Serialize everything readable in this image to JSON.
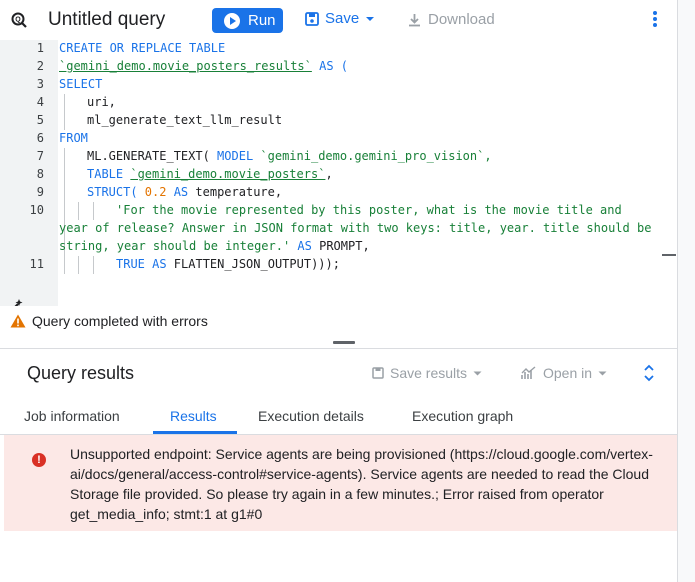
{
  "header": {
    "title": "Untitled query",
    "run_label": "Run",
    "save_label": "Save",
    "download_label": "Download"
  },
  "editor": {
    "line_numbers": [
      "1",
      "2",
      "3",
      "4",
      "5",
      "6",
      "7",
      "8",
      "9",
      "10",
      "11"
    ],
    "lines": {
      "l1_kw": "CREATE OR REPLACE TABLE",
      "l2_tbl": "`gemini_demo.movie_posters_results`",
      "l2_kw": " AS (",
      "l3_kw": "SELECT",
      "l4": "uri,",
      "l5": "ml_generate_text_llm_result",
      "l6_kw": "FROM",
      "l7_a": "ML.GENERATE_TEXT( ",
      "l7_kw": "MODEL",
      "l7_b": " `gemini_demo.gemini_pro_vision`,",
      "l8_kw": "TABLE",
      "l8_tbl": "`gemini_demo.movie_posters`",
      "l8_b": ",",
      "l9_kw": "STRUCT(",
      "l9_num": " 0.2",
      "l9_kw2": " AS",
      "l9_b": " temperature,",
      "l10_a": "'For the movie represented by this poster, what is the movie title and",
      "l10_b": "year of release? Answer in JSON format with two keys: title, year. title should be",
      "l10_c": "string, year should be integer.'",
      "l10_kw": " AS",
      "l10_d": " PROMPT,",
      "l11_kw": "TRUE AS",
      "l11_b": " FLATTEN_JSON_OUTPUT)));"
    }
  },
  "status": {
    "text": "Query completed with errors",
    "warning_color": "#e37400"
  },
  "results": {
    "title": "Query results",
    "save_results_label": "Save results",
    "open_in_label": "Open in",
    "tabs": [
      "Job information",
      "Results",
      "Execution details",
      "Execution graph"
    ],
    "active_tab": "Results",
    "error_message": "Unsupported endpoint: Service agents are being provisioned (https://cloud.google.com/vertex-ai/docs/general/access-control#service-agents). Service agents are needed to read the Cloud Storage file provided. So please try again in a few minutes.; Error raised from operator get_media_info; stmt:1 at g1#0"
  },
  "icons": {
    "query": "query-icon",
    "run": "play-icon",
    "save": "save-icon",
    "download": "download-icon",
    "more": "more-vert-icon",
    "magic": "magic-wand-icon",
    "warning": "warning-icon",
    "error": "error-icon",
    "expand": "unfold-icon",
    "open_in": "chart-icon"
  },
  "colors": {
    "accent": "#1a73e8",
    "error_bg": "#fce8e6",
    "error_icon": "#d93025"
  }
}
